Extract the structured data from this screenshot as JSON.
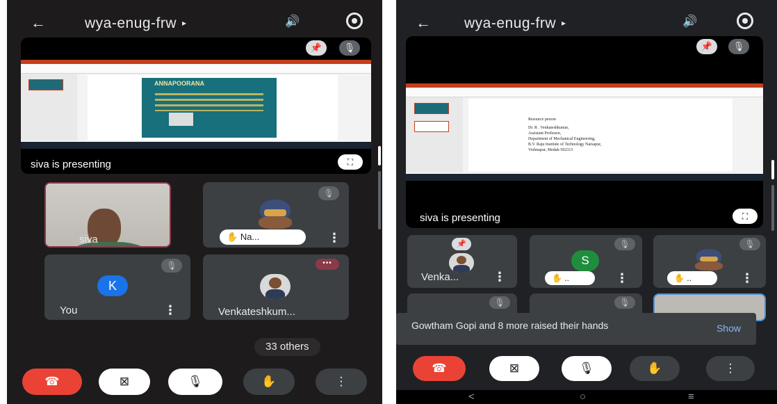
{
  "left": {
    "header": {
      "title": "wya-enug-frw",
      "caret": "▸",
      "back_icon": "←",
      "speaker_icon": "🔊"
    },
    "presentation": {
      "label": "siva is presenting",
      "pin_icon": "📌",
      "mic_off_icon": "🎙",
      "fullscreen_icon": "⛶",
      "poster_title": "ANNAPOORANA"
    },
    "tiles": [
      {
        "name": "siva",
        "more": "⋮"
      },
      {
        "name": "Na...",
        "hand_icon": "✋",
        "more": "⋮",
        "mic_off": "🎙"
      },
      {
        "name": "You",
        "avatar_letter": "K",
        "more": "⋮",
        "mic_off": "🎙"
      },
      {
        "name": "Venkateshkum...",
        "more": "⋮",
        "typing": "•••"
      }
    ],
    "others_label": "33 others",
    "controls": {
      "end_icon": "☎",
      "camera_icon": "⊠",
      "mic_icon": "🎙",
      "hand_icon": "✋",
      "more_icon": "⋮"
    }
  },
  "right": {
    "header": {
      "title": "wya-enug-frw",
      "caret": "▸",
      "back_icon": "←",
      "speaker_icon": "🔊"
    },
    "presentation": {
      "label": "siva is presenting",
      "pin_icon": "📌",
      "mic_off_icon": "🎙",
      "fullscreen_icon": "⛶",
      "doc_lines": [
        "Resource person",
        "Dr. R . Venkateshkumar,",
        "Assistant Professor,",
        "Department of Mechanical Engineering,",
        "B.V. Raju Institute of Technology Narsapur,",
        "Vishnupur, Medak-502313"
      ]
    },
    "tiles": [
      {
        "name": "Venka...",
        "more": "⋮",
        "pin_icon": "📌"
      },
      {
        "avatar_letter": "S",
        "hand_icon": "✋",
        "hand_text": "..",
        "more": "⋮",
        "mic_off": "🎙"
      },
      {
        "hand_icon": "✋",
        "hand_text": "..",
        "more": "⋮",
        "mic_off": "🎙"
      }
    ],
    "snackbar": {
      "message": "Gowtham Gopi and 8 more raised their hands",
      "action": "Show"
    },
    "controls": {
      "end_icon": "☎",
      "camera_icon": "⊠",
      "mic_icon": "🎙",
      "hand_icon": "✋",
      "more_icon": "⋮"
    },
    "navbar": {
      "back": "<",
      "home": "○",
      "recents": "≡"
    }
  },
  "colors": {
    "end_call": "#ea4335",
    "tile": "#3c4043",
    "accent_link": "#8ab4f8",
    "avatar_k": "#1a73e8",
    "avatar_s": "#1e8e3e"
  }
}
